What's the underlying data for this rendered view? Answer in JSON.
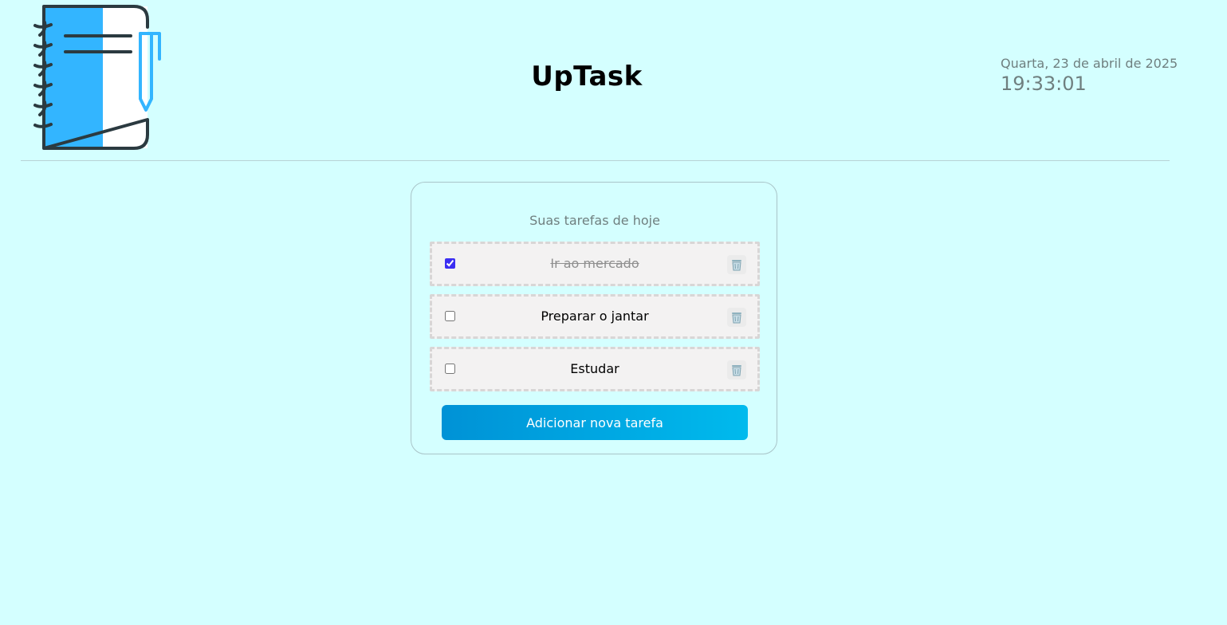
{
  "header": {
    "title": "UpTask",
    "logo_icon": "notebook-pen-icon",
    "date": "Quarta, 23 de abril de 2025",
    "time": "19:33:01"
  },
  "card": {
    "subtitle": "Suas tarefas de hoje",
    "tasks": [
      {
        "label": "Ir ao mercado",
        "done": true,
        "delete_icon": "trash-icon"
      },
      {
        "label": "Preparar o jantar",
        "done": false,
        "delete_icon": "trash-icon"
      },
      {
        "label": "Estudar",
        "done": false,
        "delete_icon": "trash-icon"
      }
    ],
    "add_button_label": "Adicionar nova tarefa"
  },
  "colors": {
    "background": "#d4ffff",
    "accent": "#00a6e2",
    "notebook_blue": "#33b5ff"
  }
}
